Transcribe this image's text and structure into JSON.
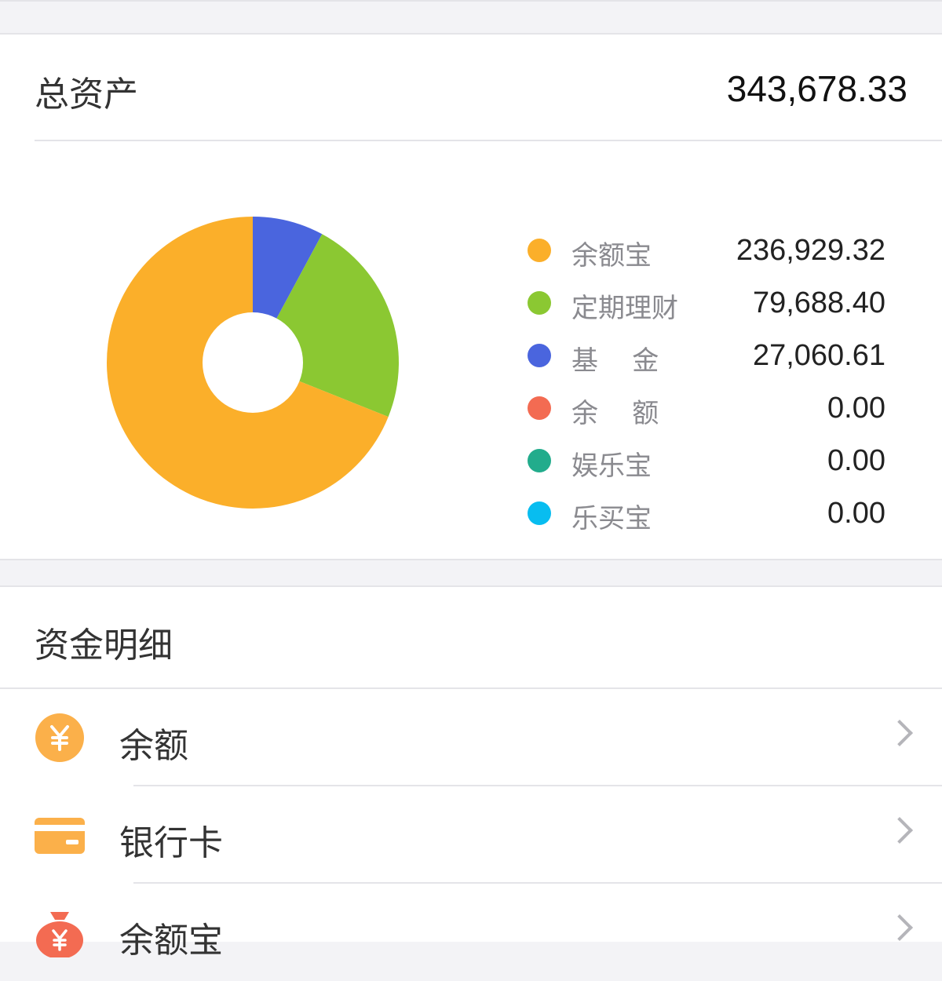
{
  "assets": {
    "total_label": "总资产",
    "total_value": "343,678.33"
  },
  "chart_data": {
    "type": "pie",
    "donut": true,
    "categories": [
      "余额宝",
      "定期理财",
      "基 金",
      "余 额",
      "娱乐宝",
      "乐买宝"
    ],
    "values": [
      236929.32,
      79688.4,
      27060.61,
      0.0,
      0.0,
      0.0
    ],
    "value_labels": [
      "236,929.32",
      "79,688.40",
      "27,060.61",
      "0.00",
      "0.00",
      "0.00"
    ],
    "colors": [
      "#FBAF2A",
      "#8BC832",
      "#4A65DE",
      "#F36B52",
      "#22AC8C",
      "#08BDF0"
    ],
    "legend_position": "right"
  },
  "legend": {
    "items": [
      {
        "label": "余额宝",
        "value": "236,929.32",
        "color": "#FBAF2A"
      },
      {
        "label": "定期理财",
        "value": "79,688.40",
        "color": "#8BC832"
      },
      {
        "label": "基    金",
        "value": "27,060.61",
        "color": "#4A65DE"
      },
      {
        "label": "余    额",
        "value": "0.00",
        "color": "#F36B52"
      },
      {
        "label": "娱乐宝",
        "value": "0.00",
        "color": "#22AC8C"
      },
      {
        "label": "乐买宝",
        "value": "0.00",
        "color": "#08BDF0"
      }
    ]
  },
  "funds": {
    "title": "资金明细",
    "items": [
      {
        "label": "余额",
        "icon": "yuan-coin-icon"
      },
      {
        "label": "银行卡",
        "icon": "bank-card-icon"
      },
      {
        "label": "余额宝",
        "icon": "money-bag-icon"
      }
    ],
    "icon_color": "#FBB04A"
  }
}
